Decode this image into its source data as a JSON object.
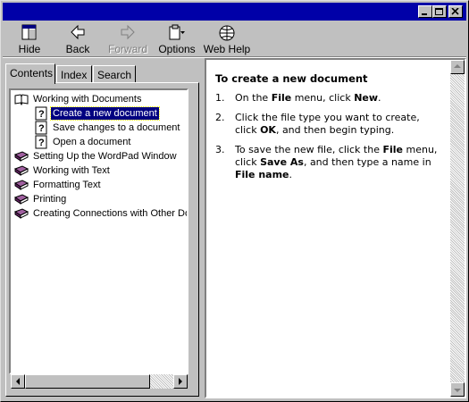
{
  "toolbar": {
    "buttons": [
      {
        "label": "Hide",
        "icon": "hide-icon",
        "enabled": true
      },
      {
        "label": "Back",
        "icon": "back-arrow-icon",
        "enabled": true
      },
      {
        "label": "Forward",
        "icon": "forward-arrow-icon",
        "enabled": false
      },
      {
        "label": "Options",
        "icon": "options-icon",
        "enabled": true
      },
      {
        "label": "Web Help",
        "icon": "web-help-icon",
        "enabled": true
      }
    ]
  },
  "tabs": [
    {
      "label": "Contents",
      "active": true
    },
    {
      "label": "Index",
      "active": false
    },
    {
      "label": "Search",
      "active": false
    }
  ],
  "tree": [
    {
      "label": "Working with Documents",
      "icon": "open-book-icon",
      "level": 0,
      "selected": false
    },
    {
      "label": "Create a new document",
      "icon": "help-page-icon",
      "level": 1,
      "selected": true
    },
    {
      "label": "Save changes to a document",
      "icon": "help-page-icon",
      "level": 1,
      "selected": false
    },
    {
      "label": "Open a document",
      "icon": "help-page-icon",
      "level": 1,
      "selected": false
    },
    {
      "label": "Setting Up the WordPad Window",
      "icon": "closed-book-icon",
      "level": 0,
      "selected": false
    },
    {
      "label": "Working with Text",
      "icon": "closed-book-icon",
      "level": 0,
      "selected": false
    },
    {
      "label": "Formatting Text",
      "icon": "closed-book-icon",
      "level": 0,
      "selected": false
    },
    {
      "label": "Printing",
      "icon": "closed-book-icon",
      "level": 0,
      "selected": false
    },
    {
      "label": "Creating Connections with Other Do",
      "icon": "closed-book-icon",
      "level": 0,
      "selected": false
    }
  ],
  "content": {
    "title": "To create a new document",
    "steps": [
      {
        "num": "1.",
        "parts": [
          "On the ",
          "File",
          " menu, click ",
          "New",
          "."
        ]
      },
      {
        "num": "2.",
        "parts": [
          "Click the file type you want to create, click ",
          "OK",
          ", and then begin typing."
        ]
      },
      {
        "num": "3.",
        "parts": [
          "To save the new file, click the ",
          "File",
          " menu, click ",
          "Save As",
          ", and then type a name in ",
          "File name",
          "."
        ]
      }
    ]
  },
  "colors": {
    "titlebar": "#0000a8",
    "selection": "#000080",
    "face": "#c0c0c0"
  }
}
